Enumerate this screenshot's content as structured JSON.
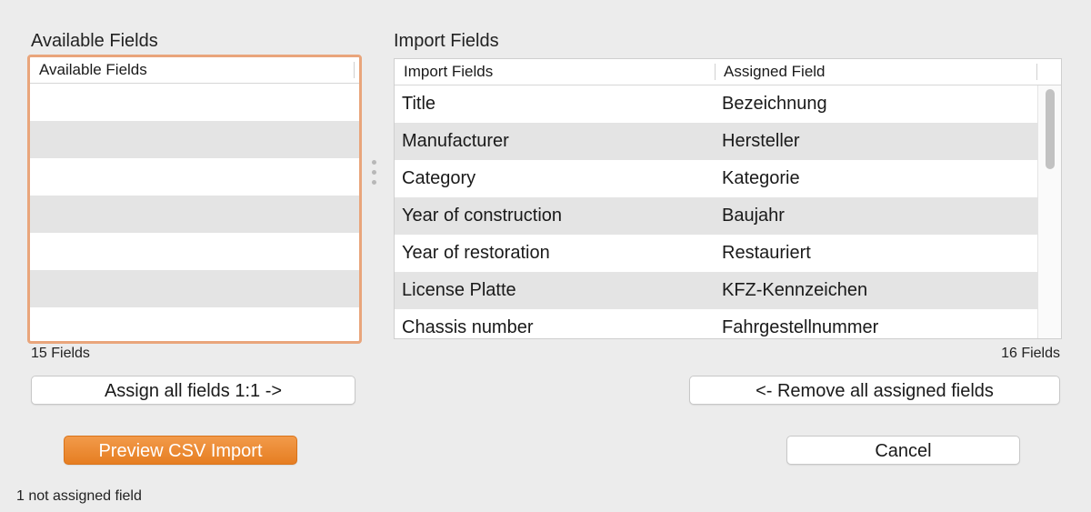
{
  "available": {
    "title": "Available Fields",
    "column_header": "Available Fields",
    "rows": [
      "",
      "",
      "",
      "",
      "",
      ""
    ],
    "count_label": "15 Fields"
  },
  "import": {
    "title": "Import Fields",
    "column_headers": [
      "Import Fields",
      "Assigned Field"
    ],
    "rows": [
      {
        "import_field": "Title",
        "assigned_field": "Bezeichnung"
      },
      {
        "import_field": "Manufacturer",
        "assigned_field": "Hersteller"
      },
      {
        "import_field": "Category",
        "assigned_field": "Kategorie"
      },
      {
        "import_field": "Year of construction",
        "assigned_field": "Baujahr"
      },
      {
        "import_field": "Year of restoration",
        "assigned_field": "Restauriert"
      },
      {
        "import_field": "License Platte",
        "assigned_field": "KFZ-Kennzeichen"
      },
      {
        "import_field": "Chassis number",
        "assigned_field": "Fahrgestellnummer"
      }
    ],
    "count_label": "16 Fields"
  },
  "buttons": {
    "assign_all": "Assign all fields 1:1 ->",
    "remove_all": "<- Remove all assigned fields",
    "preview": "Preview CSV Import",
    "cancel": "Cancel"
  },
  "status_text": "1 not assigned field",
  "colors": {
    "focus_ring": "#e9a57b",
    "primary_button": "#e67e22",
    "alt_row": "#e4e4e4",
    "background": "#ececec"
  },
  "icons": {
    "splitter": "split-view-handle-icon"
  }
}
